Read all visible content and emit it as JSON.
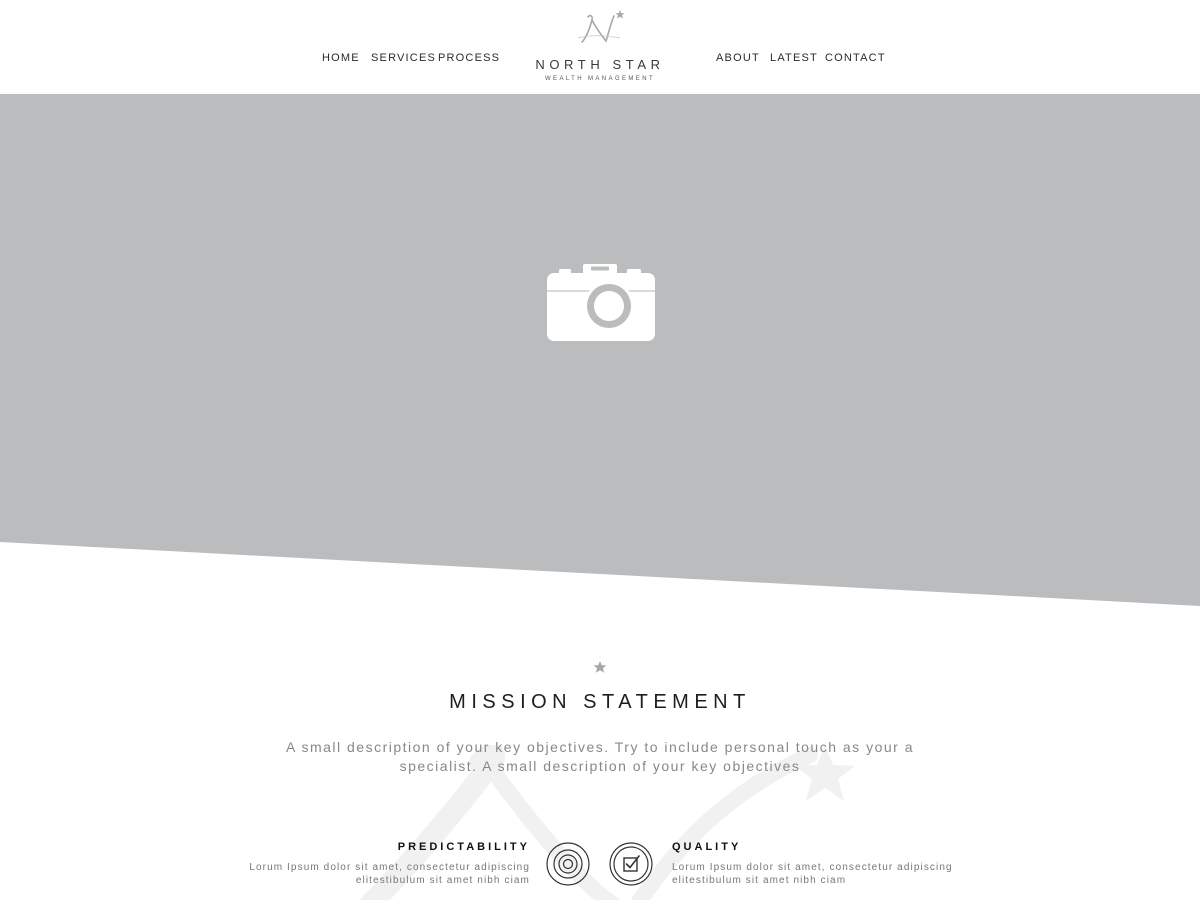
{
  "nav": {
    "left": [
      {
        "label": "HOME"
      },
      {
        "label": "SERVICES"
      },
      {
        "label": "PROCESS"
      }
    ],
    "right": [
      {
        "label": "ABOUT"
      },
      {
        "label": "LATEST"
      },
      {
        "label": "CONTACT"
      }
    ]
  },
  "logo": {
    "monogram": "N",
    "name": "NORTH STAR",
    "tagline": "WEALTH MANAGEMENT"
  },
  "hero": {
    "placeholder_icon": "camera-icon",
    "background_color": "#bbbcbe"
  },
  "mission": {
    "divider_icon": "star-icon",
    "title": "MISSION STATEMENT",
    "description_line1": "A small description of your key objectives. Try to include personal touch as your a",
    "description_line2": "specialist. A small description of your key objectives"
  },
  "features": [
    {
      "title": "PREDICTABILITY",
      "text_line1": "Lorum Ipsum dolor sit amet, consectetur adipiscing",
      "text_line2": "elitestibulum sit amet nibh ciam",
      "icon": "target-icon"
    },
    {
      "title": "QUALITY",
      "text_line1": "Lorum Ipsum dolor sit amet, consectetur adipiscing",
      "text_line2": "elitestibulum sit amet nibh ciam",
      "icon": "checkbox-icon"
    }
  ],
  "colors": {
    "hero_gray": "#bbbcbe",
    "text_dark": "#1e1e1e",
    "text_muted": "#888888",
    "accent_gray": "#a7a8ab"
  }
}
